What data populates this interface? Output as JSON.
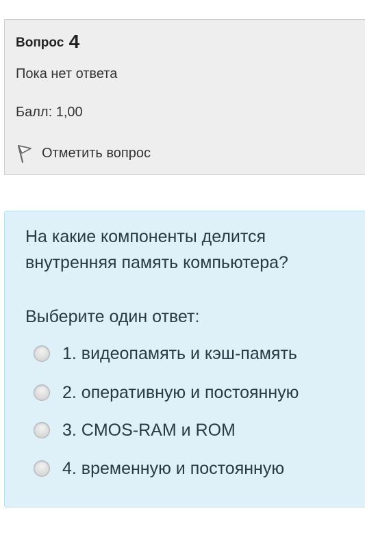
{
  "question_info": {
    "heading_label": "Вопрос",
    "number": "4",
    "state": "Пока нет ответа",
    "grade": "Балл: 1,00",
    "flag_label": "Отметить вопрос"
  },
  "question": {
    "text": "На какие компоненты делится внутренняя память компьютера?",
    "prompt": "Выберите один ответ:",
    "answers": [
      {
        "label": "1. видеопамять и кэш-память",
        "selected": false
      },
      {
        "label": "2. оперативную и постоянную",
        "selected": false
      },
      {
        "label": "3. CMOS-RAM и ROM",
        "selected": false
      },
      {
        "label": "4. временную и постоянную",
        "selected": false
      }
    ]
  },
  "colors": {
    "info_background": "#eeeeee",
    "content_background": "#def0f8"
  },
  "icons": {
    "flag": "flag-icon",
    "radio": "radio-button-icon"
  }
}
